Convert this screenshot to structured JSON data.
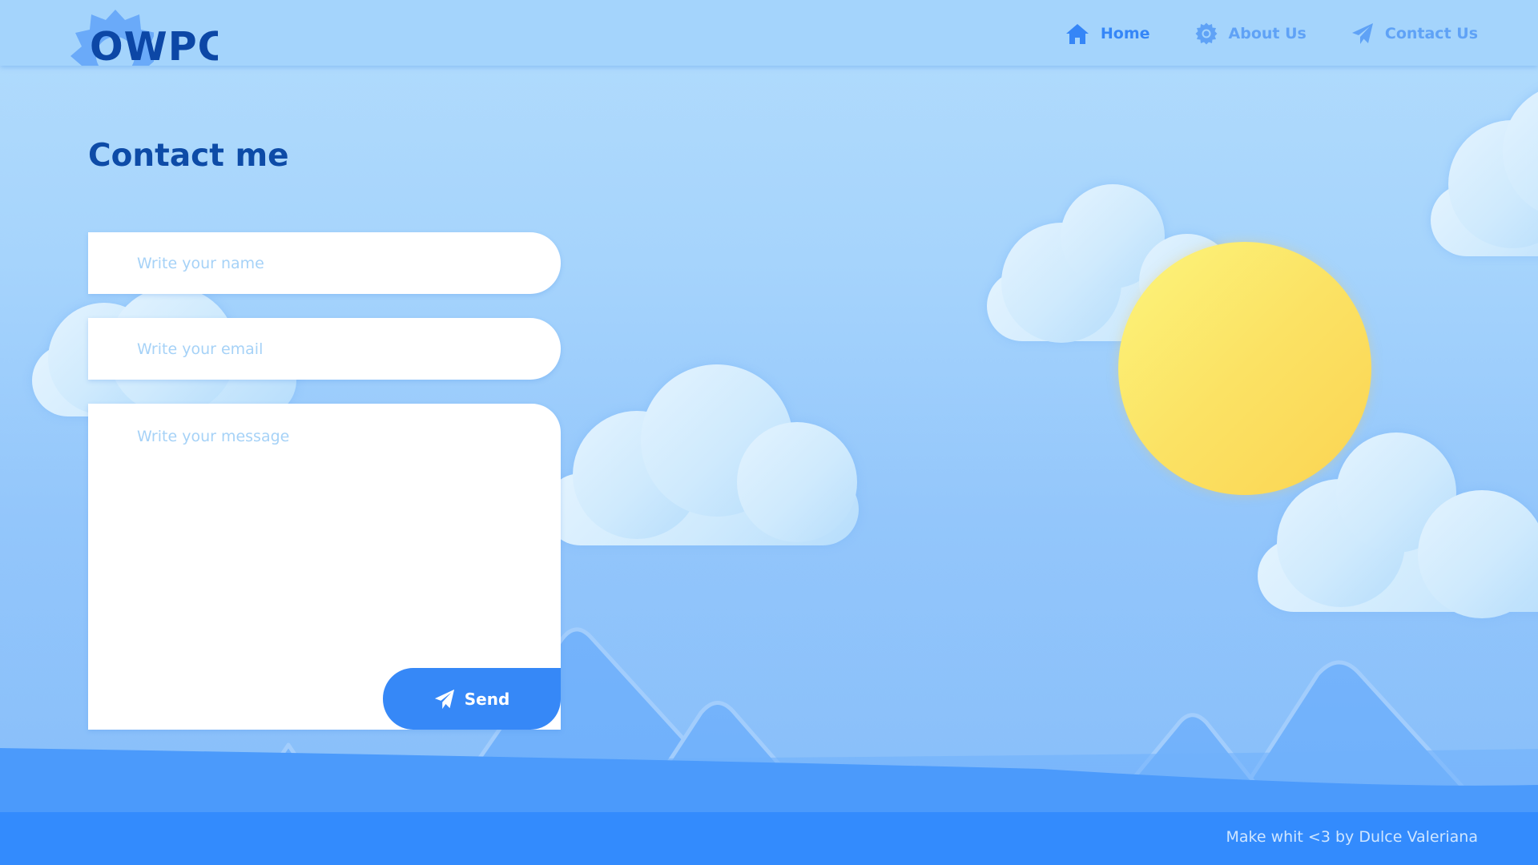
{
  "brand": {
    "logo_text": "OWPC"
  },
  "nav": {
    "items": [
      {
        "label": "Home",
        "icon": "home-icon",
        "active": true
      },
      {
        "label": "About Us",
        "icon": "gear-icon",
        "active": false
      },
      {
        "label": "Contact Us",
        "icon": "paper-plane-icon",
        "active": false
      }
    ]
  },
  "main": {
    "title": "Contact me",
    "form": {
      "name_placeholder": "Write your name",
      "email_placeholder": "Write your email",
      "message_placeholder": "Write your message",
      "send_label": "Send"
    }
  },
  "footer": {
    "text": "Make whit <3 by Dulce Valeriana"
  },
  "colors": {
    "header_bg": "#a4d4fc",
    "brand_dark": "#0d4ba7",
    "accent": "#3688f7",
    "nav_inactive": "#5fa2f6",
    "footer_bg": "#338bfd",
    "sun": "#fbe264",
    "placeholder": "#a6d2f7"
  }
}
